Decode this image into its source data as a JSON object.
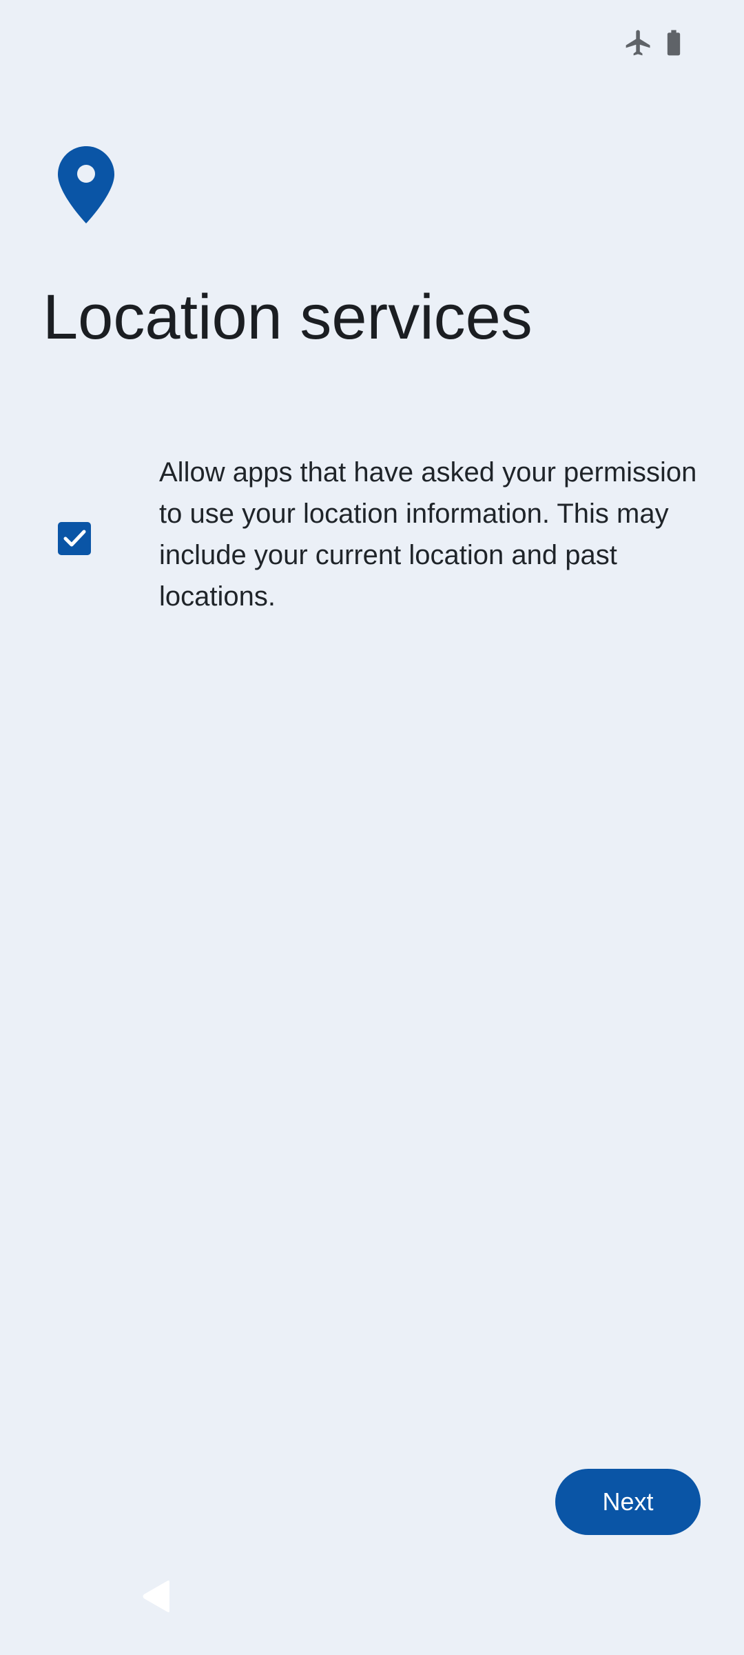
{
  "status_bar": {
    "icons": [
      "airplane-mode-icon",
      "battery-icon"
    ]
  },
  "header": {
    "icon": "location-pin-icon",
    "title": "Location services"
  },
  "location_option": {
    "checked": true,
    "description": "Allow apps that have asked your permission to use your location information. This may include your current location and past locations."
  },
  "actions": {
    "next_label": "Next"
  },
  "navigation": {
    "back_icon": "back-icon"
  },
  "colors": {
    "background": "#ebf0f7",
    "accent": "#0a55a6",
    "text_primary": "#1b1e22",
    "status_icon": "#5f6368"
  }
}
